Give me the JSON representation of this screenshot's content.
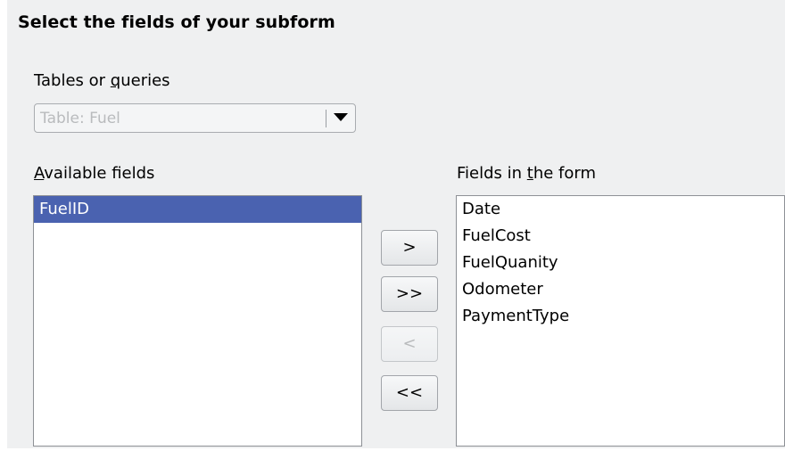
{
  "header": {
    "title": "Select the fields of your subform"
  },
  "tables_queries": {
    "label_pre": "Tables or ",
    "label_mnemonic": "q",
    "label_post": "ueries",
    "selected_value": "Table: Fuel"
  },
  "available_fields": {
    "label_pre": "",
    "label_mnemonic": "A",
    "label_post": "vailable fields",
    "items": [
      "FuelID"
    ],
    "selected_index": 0
  },
  "fields_in_form": {
    "label_pre": "Fields in ",
    "label_mnemonic": "t",
    "label_post": "he form",
    "items": [
      "Date",
      "FuelCost",
      "FuelQuanity",
      "Odometer",
      "PaymentType"
    ]
  },
  "buttons": {
    "move_selected_right": ">",
    "move_all_right": ">>",
    "move_selected_left": "<",
    "move_all_left": "<<"
  },
  "colors": {
    "selection_bg": "#4a62b0",
    "panel_bg": "#eff0f1",
    "disabled_text": "#b9bbbd"
  }
}
